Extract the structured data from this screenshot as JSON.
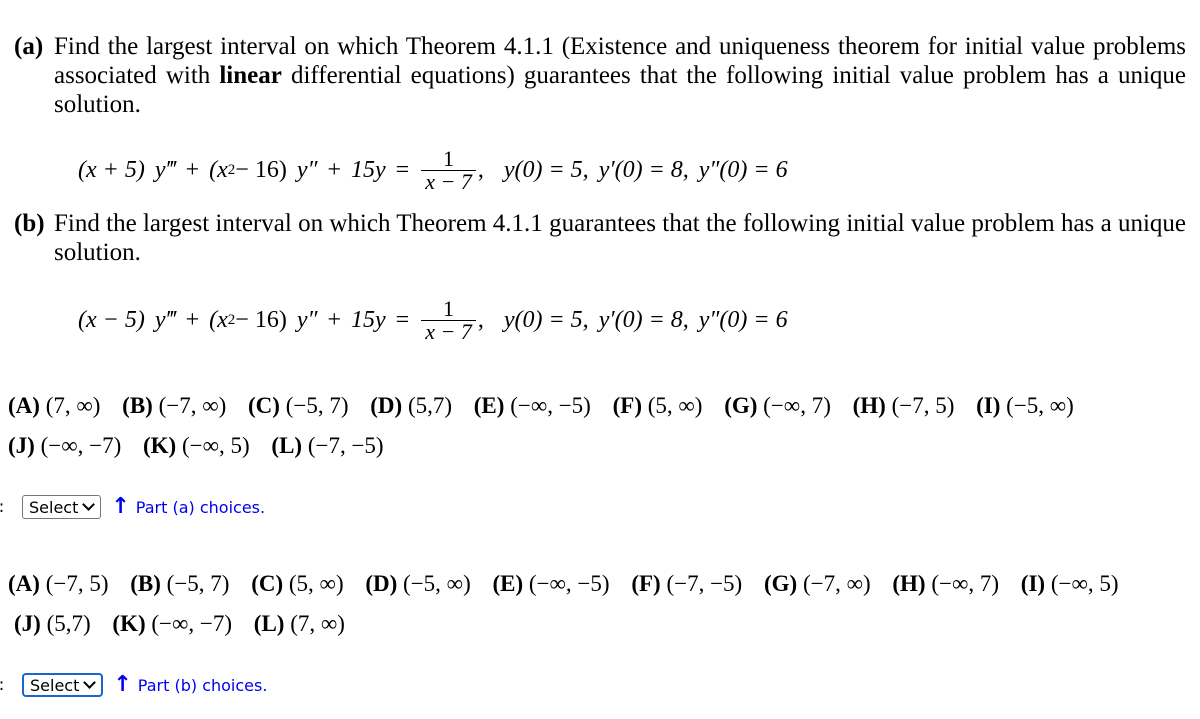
{
  "part_a": {
    "label": "(a)",
    "prompt_before_bold": "Find the largest interval on which Theorem 4.1.1 (Existence and uniqueness theorem for initial value problems associated with ",
    "prompt_bold": "linear",
    "prompt_after_bold": " differential equations) guarantees that the following initial value problem has a unique solution.",
    "equation": {
      "coef1": "(x + 5)",
      "deriv1": "y‴",
      "plus1": "+",
      "coef2_open": "(x",
      "coef2_exp": "2",
      "coef2_rest": " − 16)",
      "deriv2": "y″",
      "plus2": "+",
      "term3": "15y",
      "equals": "=",
      "rhs_num": "1",
      "rhs_den": "x − 7",
      "comma": ",",
      "ic1": "y(0) = 5,",
      "ic2": "y′(0) = 8,",
      "ic3": "y″(0) = 6"
    },
    "choices": [
      {
        "label": "(A)",
        "value": "(7, ∞)"
      },
      {
        "label": "(B)",
        "value": "(−7, ∞)"
      },
      {
        "label": "(C)",
        "value": "(−5, 7)"
      },
      {
        "label": "(D)",
        "value": "(5,7)"
      },
      {
        "label": "(E)",
        "value": "(−∞, −5)"
      },
      {
        "label": "(F)",
        "value": "(5, ∞)"
      },
      {
        "label": "(G)",
        "value": "(−∞, 7)"
      },
      {
        "label": "(H)",
        "value": "(−7, 5)"
      },
      {
        "label": "(I)",
        "value": "(−5, ∞)"
      },
      {
        "label": "(J)",
        "value": "(−∞, −7)"
      },
      {
        "label": "(K)",
        "value": "(−∞, 5)"
      },
      {
        "label": "(L)",
        "value": "(−7, −5)"
      }
    ],
    "answer_prefix": "):",
    "select_value": "Select",
    "hint": "Part (a) choices."
  },
  "part_b": {
    "label": "(b)",
    "prompt": "Find the largest interval on which Theorem 4.1.1 guarantees that the following initial value problem has a unique solution.",
    "equation": {
      "coef1": "(x − 5)",
      "deriv1": "y‴",
      "plus1": "+",
      "coef2_open": "(x",
      "coef2_exp": "2",
      "coef2_rest": " − 16)",
      "deriv2": "y″",
      "plus2": "+",
      "term3": "15y",
      "equals": "=",
      "rhs_num": "1",
      "rhs_den": "x − 7",
      "comma": ",",
      "ic1": "y(0) = 5,",
      "ic2": "y′(0) = 8,",
      "ic3": "y″(0) = 6"
    },
    "choices": [
      {
        "label": "(A)",
        "value": "(−7, 5)"
      },
      {
        "label": "(B)",
        "value": "(−5, 7)"
      },
      {
        "label": "(C)",
        "value": "(5, ∞)"
      },
      {
        "label": "(D)",
        "value": "(−5, ∞)"
      },
      {
        "label": "(E)",
        "value": "(−∞, −5)"
      },
      {
        "label": "(F)",
        "value": "(−7, −5)"
      },
      {
        "label": "(G)",
        "value": "(−7, ∞)"
      },
      {
        "label": "(H)",
        "value": "(−∞, 7)"
      },
      {
        "label": "(I)",
        "value": "(−∞, 5)"
      },
      {
        "label": "(J)",
        "value": "(5,7)"
      },
      {
        "label": "(K)",
        "value": "(−∞, −7)"
      },
      {
        "label": "(L)",
        "value": "(7, ∞)"
      }
    ],
    "answer_prefix": "):",
    "select_value": "Select",
    "hint": "Part (b) choices."
  },
  "colors": {
    "hint_link": "#0000ee",
    "focus_ring": "#1a64d6"
  },
  "icons": {
    "select_chevron": "chevron-down-icon",
    "hint_arrow": "arrow-up-icon"
  }
}
